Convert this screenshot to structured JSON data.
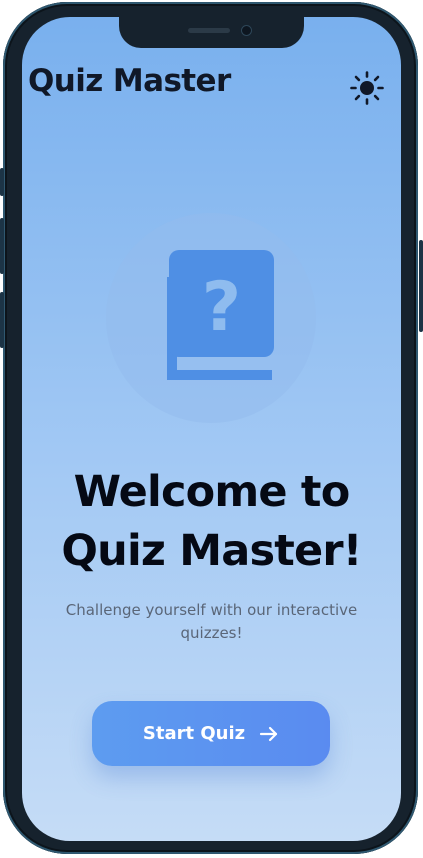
{
  "app": {
    "title": "Quiz Master",
    "theme_icon": "sun-icon"
  },
  "hero": {
    "icon": "quiz-question-cards-icon",
    "heading": "Welcome to Quiz Master!",
    "subtitle": "Challenge yourself with our interactive quizzes!"
  },
  "actions": {
    "start_label": "Start Quiz",
    "start_icon": "arrow-right-icon"
  },
  "colors": {
    "accent": "#5b93f0",
    "icon_blue": "#4f8fe4",
    "background_top": "#79b0ee",
    "background_bottom": "#c5dcf6",
    "heading": "#050914",
    "subtitle": "#5a6678"
  }
}
